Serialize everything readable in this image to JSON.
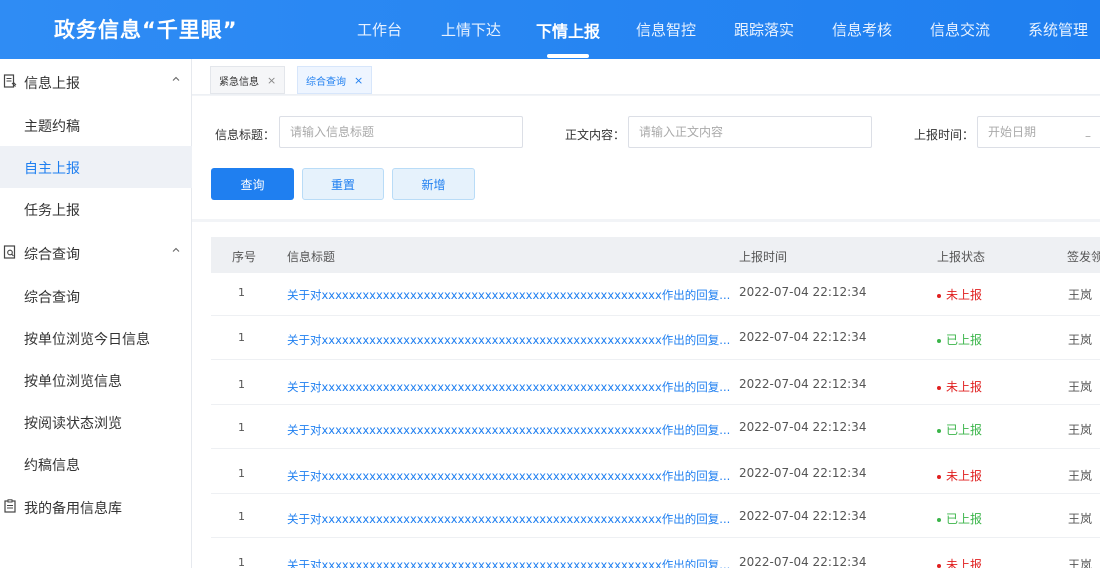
{
  "app": {
    "title": "政务信息“千里眼”"
  },
  "nav": [
    {
      "label": "工作台"
    },
    {
      "label": "上情下达"
    },
    {
      "label": "下情上报"
    },
    {
      "label": "信息智控"
    },
    {
      "label": "跟踪落实"
    },
    {
      "label": "信息考核"
    },
    {
      "label": "信息交流"
    },
    {
      "label": "系统管理"
    }
  ],
  "sidebar": {
    "group1": {
      "label": "信息上报",
      "items": [
        "主题约稿",
        "自主上报",
        "任务上报"
      ]
    },
    "group2": {
      "label": "综合查询",
      "items": [
        "综合查询",
        "按单位浏览今日信息",
        "按单位浏览信息",
        "按阅读状态浏览",
        "约稿信息"
      ]
    },
    "group3": {
      "label": "我的备用信息库"
    }
  },
  "tabs": [
    {
      "label": "紧急信息",
      "close": "×"
    },
    {
      "label": "综合查询",
      "close": "×"
    }
  ],
  "search": {
    "title_label": "信息标题：",
    "title_placeholder": "请输入信息标题",
    "body_label": "正文内容：",
    "body_placeholder": "请输入正文内容",
    "time_label": "上报时间：",
    "time_placeholder": "开始日期",
    "time_sep": "–",
    "query_button": "查询",
    "reset_button": "重置",
    "add_button": "新增"
  },
  "table": {
    "columns": [
      "序号",
      "信息标题",
      "上报时间",
      "上报状态",
      "签发领"
    ],
    "rows": [
      {
        "no": "1",
        "title": "关于对xxxxxxxxxxxxxxxxxxxxxxxxxxxxxxxxxxxxxxxxxxxxxxxxxx作出的回复...",
        "time": "2022-07-04  22:12:34",
        "status": "未上报",
        "signer": "王岚"
      },
      {
        "no": "1",
        "title": "关于对xxxxxxxxxxxxxxxxxxxxxxxxxxxxxxxxxxxxxxxxxxxxxxxxxx作出的回复...",
        "time": "2022-07-04  22:12:34",
        "status": "已上报",
        "signer": "王岚"
      },
      {
        "no": "1",
        "title": "关于对xxxxxxxxxxxxxxxxxxxxxxxxxxxxxxxxxxxxxxxxxxxxxxxxxx作出的回复...",
        "time": "2022-07-04  22:12:34",
        "status": "未上报",
        "signer": "王岚"
      },
      {
        "no": "1",
        "title": "关于对xxxxxxxxxxxxxxxxxxxxxxxxxxxxxxxxxxxxxxxxxxxxxxxxxx作出的回复...",
        "time": "2022-07-04  22:12:34",
        "status": "已上报",
        "signer": "王岚"
      },
      {
        "no": "1",
        "title": "关于对xxxxxxxxxxxxxxxxxxxxxxxxxxxxxxxxxxxxxxxxxxxxxxxxxx作出的回复...",
        "time": "2022-07-04  22:12:34",
        "status": "未上报",
        "signer": "王岚"
      },
      {
        "no": "1",
        "title": "关于对xxxxxxxxxxxxxxxxxxxxxxxxxxxxxxxxxxxxxxxxxxxxxxxxxx作出的回复...",
        "time": "2022-07-04  22:12:34",
        "status": "已上报",
        "signer": "王岚"
      },
      {
        "no": "1",
        "title": "关于对xxxxxxxxxxxxxxxxxxxxxxxxxxxxxxxxxxxxxxxxxxxxxxxxxx作出的回复...",
        "time": "2022-07-04  22:12:34",
        "status": "未上报",
        "signer": "王岚"
      }
    ]
  },
  "colors": {
    "brand": "#1f7ff0",
    "status_pending": "#e02020",
    "status_done": "#3bb54a"
  },
  "icons": {
    "group1": "report-doc-icon",
    "group2": "search-doc-icon",
    "group3": "clipboard-icon"
  }
}
